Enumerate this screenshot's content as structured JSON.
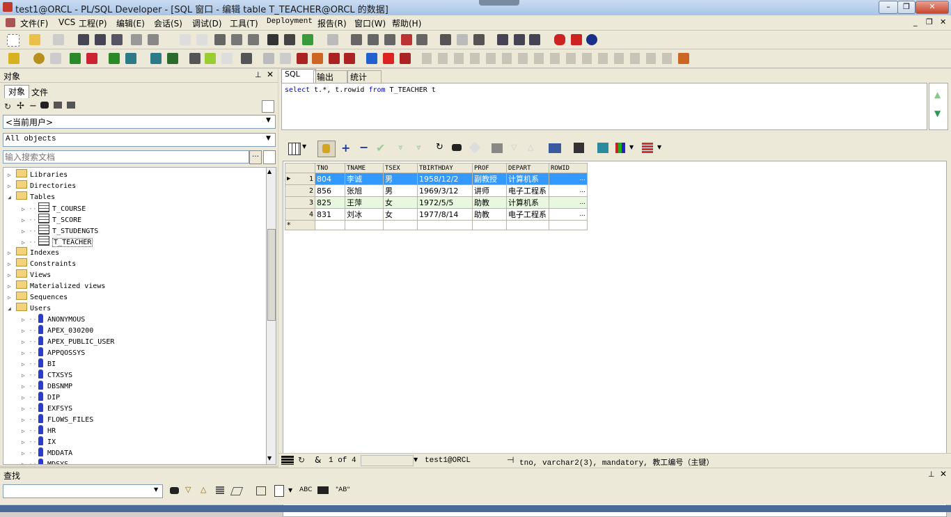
{
  "window": {
    "title": "test1@ORCL - PL/SQL Developer - [SQL 窗口 - 编辑 table T_TEACHER@ORCL 的数据]"
  },
  "menu": [
    "文件(F)",
    "VCS",
    "工程(P)",
    "编辑(E)",
    "会话(S)",
    "调试(D)",
    "工具(T)",
    "Deployment",
    "报告(R)",
    "窗口(W)",
    "帮助(H)"
  ],
  "objects_panel": {
    "title": "对象",
    "tabs": [
      "对象",
      "文件"
    ],
    "user_select": "<当前用户>",
    "filter_select": "All objects",
    "search_placeholder": "输入搜索文档",
    "tree": [
      {
        "label": "Libraries",
        "type": "folder",
        "level": 0,
        "expanded": false
      },
      {
        "label": "Directories",
        "type": "folder",
        "level": 0,
        "expanded": false
      },
      {
        "label": "Tables",
        "type": "folder",
        "level": 0,
        "expanded": true
      },
      {
        "label": "T_COURSE",
        "type": "table",
        "level": 1
      },
      {
        "label": "T_SCORE",
        "type": "table",
        "level": 1
      },
      {
        "label": "T_STUDENGTS",
        "type": "table",
        "level": 1
      },
      {
        "label": "T_TEACHER",
        "type": "table",
        "level": 1,
        "selected": true
      },
      {
        "label": "Indexes",
        "type": "folder",
        "level": 0,
        "expanded": false
      },
      {
        "label": "Constraints",
        "type": "folder",
        "level": 0,
        "expanded": false
      },
      {
        "label": "Views",
        "type": "folder",
        "level": 0,
        "expanded": false
      },
      {
        "label": "Materialized views",
        "type": "folder",
        "level": 0,
        "expanded": false
      },
      {
        "label": "Sequences",
        "type": "folder",
        "level": 0,
        "expanded": false
      },
      {
        "label": "Users",
        "type": "folder",
        "level": 0,
        "expanded": true
      },
      {
        "label": "ANONYMOUS",
        "type": "user",
        "level": 1
      },
      {
        "label": "APEX_030200",
        "type": "user",
        "level": 1
      },
      {
        "label": "APEX_PUBLIC_USER",
        "type": "user",
        "level": 1
      },
      {
        "label": "APPQOSSYS",
        "type": "user",
        "level": 1
      },
      {
        "label": "BI",
        "type": "user",
        "level": 1
      },
      {
        "label": "CTXSYS",
        "type": "user",
        "level": 1
      },
      {
        "label": "DBSNMP",
        "type": "user",
        "level": 1
      },
      {
        "label": "DIP",
        "type": "user",
        "level": 1
      },
      {
        "label": "EXFSYS",
        "type": "user",
        "level": 1
      },
      {
        "label": "FLOWS_FILES",
        "type": "user",
        "level": 1
      },
      {
        "label": "HR",
        "type": "user",
        "level": 1
      },
      {
        "label": "IX",
        "type": "user",
        "level": 1
      },
      {
        "label": "MDDATA",
        "type": "user",
        "level": 1
      },
      {
        "label": "MDSYS",
        "type": "user",
        "level": 1
      }
    ]
  },
  "editor": {
    "tabs": [
      "SQL",
      "输出",
      "统计"
    ],
    "sql_parts": [
      {
        "text": "select ",
        "kw": true
      },
      {
        "text": "t.*, t.rowid ",
        "kw": false
      },
      {
        "text": "from ",
        "kw": true
      },
      {
        "text": "T_TEACHER t",
        "kw": false
      }
    ]
  },
  "grid": {
    "columns": [
      "TNO",
      "TNAME",
      "TSEX",
      "TBIRTHDAY",
      "PROF",
      "DEPART",
      "ROWID"
    ],
    "rows": [
      [
        "1",
        "804",
        "李诚",
        "男",
        "1958/12/2",
        "副教授",
        "计算机系",
        "..."
      ],
      [
        "2",
        "856",
        "张旭",
        "男",
        "1969/3/12",
        "讲师",
        "电子工程系",
        "..."
      ],
      [
        "3",
        "825",
        "王萍",
        "女",
        "1972/5/5",
        "助教",
        "计算机系",
        "..."
      ],
      [
        "4",
        "831",
        "刘冰",
        "女",
        "1977/8/14",
        "助教",
        "电子工程系",
        "..."
      ]
    ],
    "new_row_marker": "*"
  },
  "status": {
    "record": "1 of 4",
    "connection": "test1@ORCL",
    "field_info": "tno, varchar2(3), mandatory, 教工编号（主键）"
  },
  "find_panel": {
    "title": "查找",
    "tools": [
      "ABC",
      "\"AB\""
    ]
  },
  "colors": {
    "selected_row": "#3399ff",
    "alt_row": "#e8f8e0",
    "keyword": "#0000cc"
  }
}
